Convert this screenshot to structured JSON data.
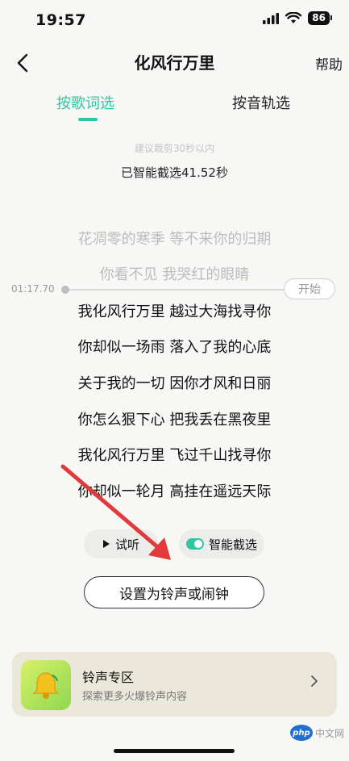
{
  "status": {
    "time": "19:57",
    "battery": "86"
  },
  "nav": {
    "title": "化风行万里",
    "help": "帮助"
  },
  "tabs": [
    {
      "label": "按歌词选"
    },
    {
      "label": "按音轨选"
    }
  ],
  "hint": "建议裁剪30秒以内",
  "selected_info": "已智能截选41.52秒",
  "timeline": {
    "time": "01:17.70",
    "start_label": "开始"
  },
  "lyrics": [
    "花凋零的寒季 等不来你的归期",
    "你看不见 我哭红的眼睛",
    "我化风行万里 越过大海找寻你",
    "你却似一场雨 落入了我的心底",
    "关于我的一切 因你才风和日丽",
    "你怎么狠下心 把我丢在黑夜里",
    "我化风行万里 飞过千山找寻你",
    "你却似一轮月 高挂在遥远天际"
  ],
  "controls": {
    "preview": "试听",
    "smart_select": "智能截选",
    "set_button": "设置为铃声或闹钟"
  },
  "card": {
    "title": "铃声专区",
    "subtitle": "探索更多火爆铃声内容"
  },
  "watermark": {
    "badge": "php",
    "text": "中文网"
  },
  "colors": {
    "accent": "#2fc7a0",
    "arrow": "#e23a3a",
    "card_bg": "#ece7db"
  }
}
